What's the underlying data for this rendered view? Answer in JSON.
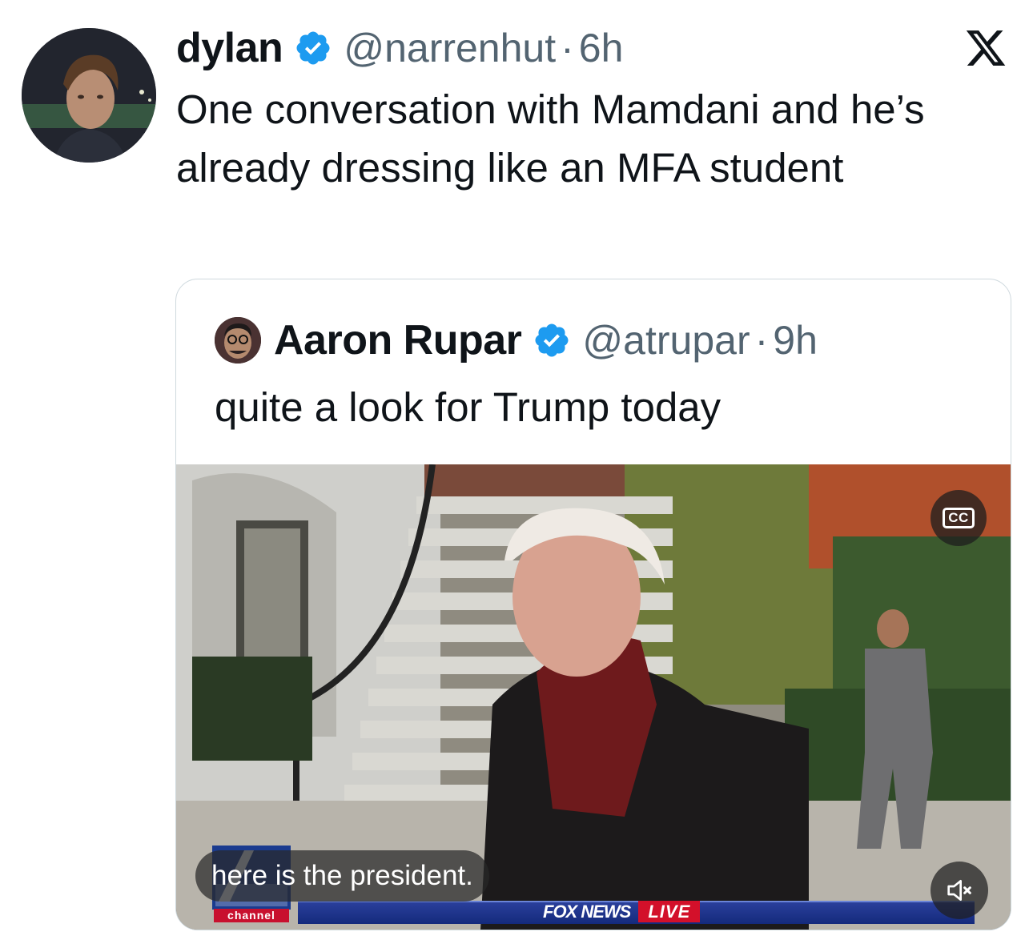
{
  "tweet": {
    "author_name": "dylan",
    "handle": "@narrenhut",
    "separator": "·",
    "time": "6h",
    "text": "One conversation with Mamdani and he’s already dressing like an MFA student",
    "verified_icon": "verified-badge-icon",
    "platform_icon": "x-logo-icon"
  },
  "quoted_tweet": {
    "author_name": "Aaron Rupar",
    "handle": "@atrupar",
    "separator": "·",
    "time": "9h",
    "text": "quite a look for Trump today",
    "verified_icon": "verified-badge-icon"
  },
  "video": {
    "caption": "here is the president.",
    "cc_label": "CC",
    "network_bug_label": "channel",
    "ticker_brand": "FOX NEWS",
    "ticker_live": "LIVE",
    "mute_icon": "speaker-muted-icon"
  },
  "colors": {
    "verified": "#1d9bf0",
    "secondary_text": "#536471",
    "border": "#cfd9de",
    "live_red": "#d3102a",
    "ticker_blue": "#1f358b"
  }
}
